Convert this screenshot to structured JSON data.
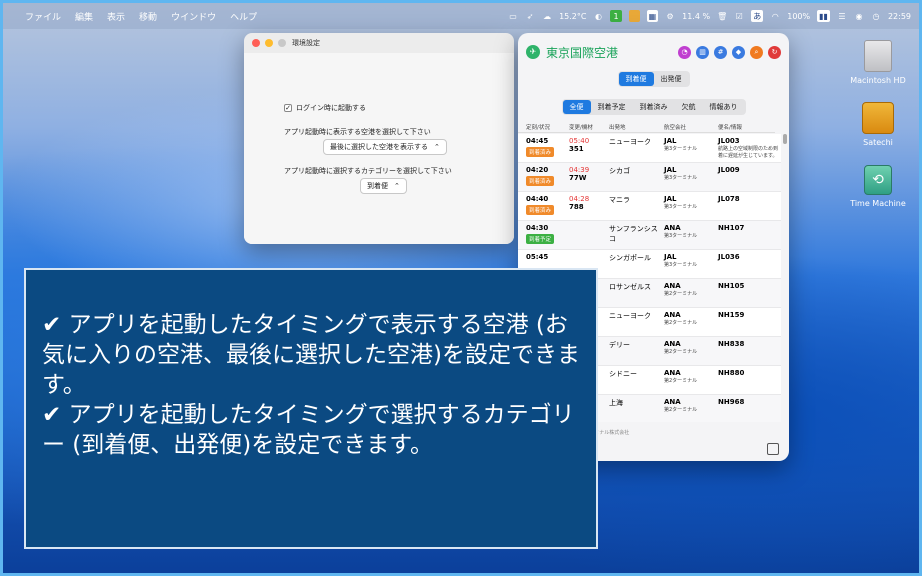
{
  "menubar": {
    "menus": [
      "ファイル",
      "編集",
      "表示",
      "移動",
      "ウインドウ",
      "ヘルプ"
    ],
    "weather": "15.2°C",
    "status_1": "1",
    "cpu": "11.4 %",
    "ime": "あ",
    "battery": "100%",
    "clock": "22:59"
  },
  "desktop": {
    "icons": [
      {
        "label": "Macintosh HD"
      },
      {
        "label": "Satechi"
      },
      {
        "label": "Time Machine"
      }
    ]
  },
  "prefs": {
    "title": "環境設定",
    "launch_at_login": "ログイン時に起動する",
    "airport_prompt": "アプリ起動時に表示する空港を選択して下さい",
    "airport_value": "最後に選択した空港を表示する",
    "category_prompt": "アプリ起動時に選択するカテゴリーを選択して下さい",
    "category_value": "到着便"
  },
  "app": {
    "airport": "東京国際空港",
    "mode_tabs": [
      "到着便",
      "出発便"
    ],
    "filter_tabs": [
      "全便",
      "到着予定",
      "到着済み",
      "欠航",
      "情報あり"
    ],
    "columns": [
      "定刻/状況",
      "変更/機材",
      "出発地",
      "航空会社",
      "便名/情報"
    ],
    "footer": "データ提供: 東京国際空港ターミナル株式会社",
    "flights": [
      {
        "time": "04:45",
        "status": "到着済み",
        "status_color": "#f08a2a",
        "changed": "05:40",
        "aircraft": "351",
        "origin": "ニューヨーク",
        "airline": "JAL",
        "terminal": "第3ターミナル",
        "flight": "JL003",
        "info": "航路上の空域制限のため到着に遅延が生じています。"
      },
      {
        "time": "04:20",
        "status": "到着済み",
        "status_color": "#f08a2a",
        "changed": "04:39",
        "aircraft": "77W",
        "origin": "シカゴ",
        "airline": "JAL",
        "terminal": "第3ターミナル",
        "flight": "JL009",
        "info": ""
      },
      {
        "time": "04:40",
        "status": "到着済み",
        "status_color": "#f08a2a",
        "changed": "04:28",
        "aircraft": "788",
        "origin": "マニラ",
        "airline": "JAL",
        "terminal": "第3ターミナル",
        "flight": "JL078",
        "info": ""
      },
      {
        "time": "04:30",
        "status": "到着予定",
        "status_color": "#3cb043",
        "changed": "",
        "aircraft": "",
        "origin": "サンフランシスコ",
        "airline": "ANA",
        "terminal": "第3ターミナル",
        "flight": "NH107",
        "info": ""
      },
      {
        "time": "05:45",
        "status": "",
        "status_color": "#3cb043",
        "changed": "",
        "aircraft": "",
        "origin": "シンガポール",
        "airline": "JAL",
        "terminal": "第3ターミナル",
        "flight": "JL036",
        "info": ""
      },
      {
        "time": "",
        "status": "",
        "status_color": "#3cb043",
        "changed": "",
        "aircraft": "",
        "origin": "ロサンゼルス",
        "airline": "ANA",
        "terminal": "第2ターミナル",
        "flight": "NH105",
        "info": ""
      },
      {
        "time": "",
        "status": "",
        "status_color": "#3cb043",
        "changed": "",
        "aircraft": "",
        "origin": "ニューヨーク",
        "airline": "ANA",
        "terminal": "第2ターミナル",
        "flight": "NH159",
        "info": ""
      },
      {
        "time": "",
        "status": "",
        "status_color": "#3cb043",
        "changed": "",
        "aircraft": "",
        "origin": "デリー",
        "airline": "ANA",
        "terminal": "第2ターミナル",
        "flight": "NH838",
        "info": ""
      },
      {
        "time": "",
        "status": "",
        "status_color": "#3cb043",
        "changed": "",
        "aircraft": "",
        "origin": "シドニー",
        "airline": "ANA",
        "terminal": "第2ターミナル",
        "flight": "NH880",
        "info": ""
      },
      {
        "time": "",
        "status": "",
        "status_color": "#3cb043",
        "changed": "",
        "aircraft": "",
        "origin": "上海",
        "airline": "ANA",
        "terminal": "第2ターミナル",
        "flight": "NH968",
        "info": ""
      }
    ]
  },
  "caption": {
    "line1": "✔ アプリを起動したタイミングで表示する空港 (お気に入りの空港、最後に選択した空港)を設定できます。",
    "line2": "✔ アプリを起動したタイミングで選択するカテゴリー (到着便、出発便)を設定できます。"
  }
}
